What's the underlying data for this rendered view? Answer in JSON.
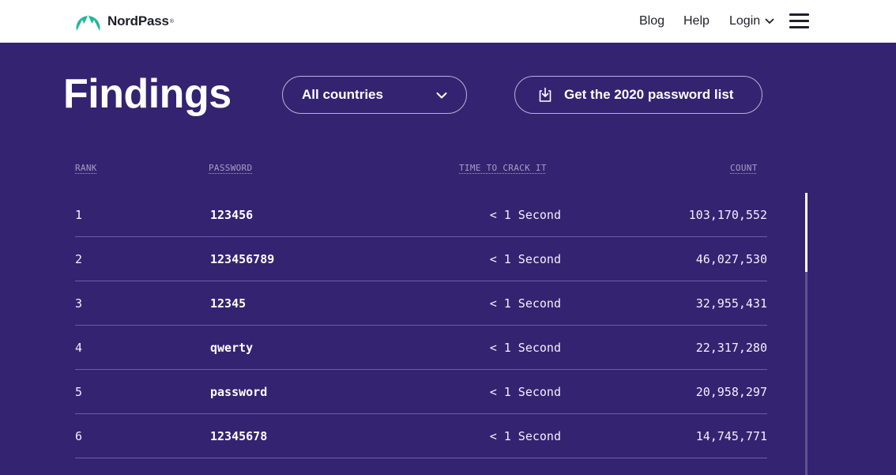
{
  "brand": {
    "name": "NordPass",
    "reg": "®"
  },
  "nav": {
    "blog": "Blog",
    "help": "Help",
    "login": "Login"
  },
  "page": {
    "title": "Findings"
  },
  "filter": {
    "selected": "All countries"
  },
  "download": {
    "label": "Get the 2020 password list"
  },
  "table": {
    "headers": {
      "rank": "RANK",
      "password": "PASSWORD",
      "time": "TIME TO CRACK IT",
      "count": "COUNT"
    },
    "rows": [
      {
        "rank": "1",
        "password": "123456",
        "time": "< 1 Second",
        "count": "103,170,552"
      },
      {
        "rank": "2",
        "password": "123456789",
        "time": "< 1 Second",
        "count": "46,027,530"
      },
      {
        "rank": "3",
        "password": "12345",
        "time": "< 1 Second",
        "count": "32,955,431"
      },
      {
        "rank": "4",
        "password": "qwerty",
        "time": "< 1 Second",
        "count": "22,317,280"
      },
      {
        "rank": "5",
        "password": "password",
        "time": "< 1 Second",
        "count": "20,958,297"
      },
      {
        "rank": "6",
        "password": "12345678",
        "time": "< 1 Second",
        "count": "14,745,771"
      }
    ]
  },
  "colors": {
    "background": "#342371",
    "accent_green": "#1fb89a",
    "header_bg": "#ffffff"
  },
  "icons": {
    "logo": "nordpass-logo-icon",
    "menu": "hamburger-menu-icon",
    "dropdown": "chevron-down-icon",
    "download": "download-icon"
  }
}
